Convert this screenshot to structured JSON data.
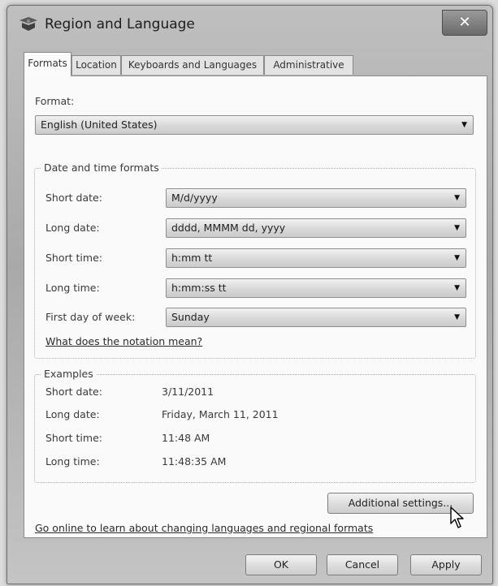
{
  "window": {
    "title": "Region and Language",
    "close_label": "✕"
  },
  "tabs": [
    {
      "label": "Formats",
      "active": true
    },
    {
      "label": "Location",
      "active": false
    },
    {
      "label": "Keyboards and Languages",
      "active": false
    },
    {
      "label": "Administrative",
      "active": false
    }
  ],
  "format": {
    "label": "Format:",
    "value": "English (United States)"
  },
  "date_time_formats": {
    "legend": "Date and time formats",
    "short_date": {
      "label": "Short date:",
      "value": "M/d/yyyy"
    },
    "long_date": {
      "label": "Long date:",
      "value": "dddd, MMMM dd, yyyy"
    },
    "short_time": {
      "label": "Short time:",
      "value": "h:mm tt"
    },
    "long_time": {
      "label": "Long time:",
      "value": "h:mm:ss tt"
    },
    "first_day": {
      "label": "First day of week:",
      "value": "Sunday"
    },
    "notation_link": "What does the notation mean?"
  },
  "examples": {
    "legend": "Examples",
    "short_date": {
      "label": "Short date:",
      "value": "3/11/2011"
    },
    "long_date": {
      "label": "Long date:",
      "value": "Friday, March 11, 2011"
    },
    "short_time": {
      "label": "Short time:",
      "value": "11:48 AM"
    },
    "long_time": {
      "label": "Long time:",
      "value": "11:48:35 AM"
    }
  },
  "additional_settings_label": "Additional settings...",
  "online_link": "Go online to learn about changing languages and regional formats",
  "footer": {
    "ok": "OK",
    "cancel": "Cancel",
    "apply": "Apply"
  }
}
